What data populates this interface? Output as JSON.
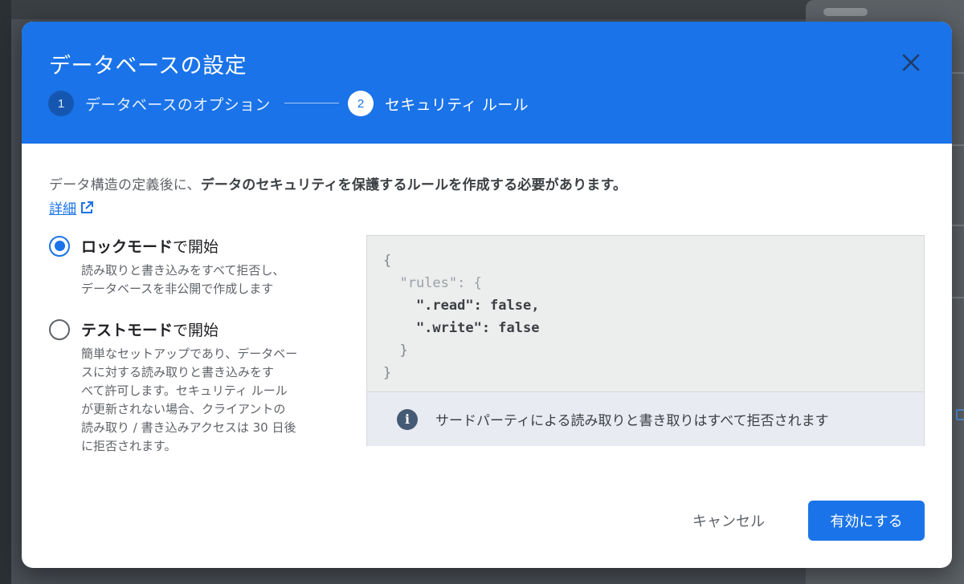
{
  "dialog": {
    "title": "データベースの設定",
    "steps": [
      {
        "number": "1",
        "label": "データベースのオプション",
        "state": "completed"
      },
      {
        "number": "2",
        "label": "セキュリティ ルール",
        "state": "active"
      }
    ],
    "close_icon": "close-icon"
  },
  "intro": {
    "text_plain": "データ構造の定義後に、",
    "text_bold": "データのセキュリティを保護するルールを作成する必要があります。",
    "learn_more_label": "詳細",
    "learn_more_icon": "external-link-icon"
  },
  "modes": [
    {
      "label_bold": "ロックモード",
      "label_rest": "で開始",
      "selected": true,
      "description": "読み取りと書き込みをすべて拒否し、\nデータベースを非公開で作成します"
    },
    {
      "label_bold": "テストモード",
      "label_rest": "で開始",
      "selected": false,
      "description": "簡単なセットアップであり、データベー\nスに対する読み取りと書き込みをす\nべて許可します。セキュリティ ルール\nが更新されない場合、クライアントの\n読み取り / 書き込みアクセスは 30 日後\nに拒否されます。"
    }
  ],
  "rules": {
    "code_lines": [
      "{",
      "  \"rules\": {",
      "    \".read\": false,",
      "    \".write\": false",
      "  }",
      "}"
    ],
    "info_text": "サードパーティによる読み取りと書き取りはすべて拒否されます",
    "info_icon": "info-icon"
  },
  "actions": {
    "cancel_label": "キャンセル",
    "enable_label": "有効にする"
  },
  "colors": {
    "accent": "#1a73e8",
    "header_bg": "#1a73e8"
  }
}
